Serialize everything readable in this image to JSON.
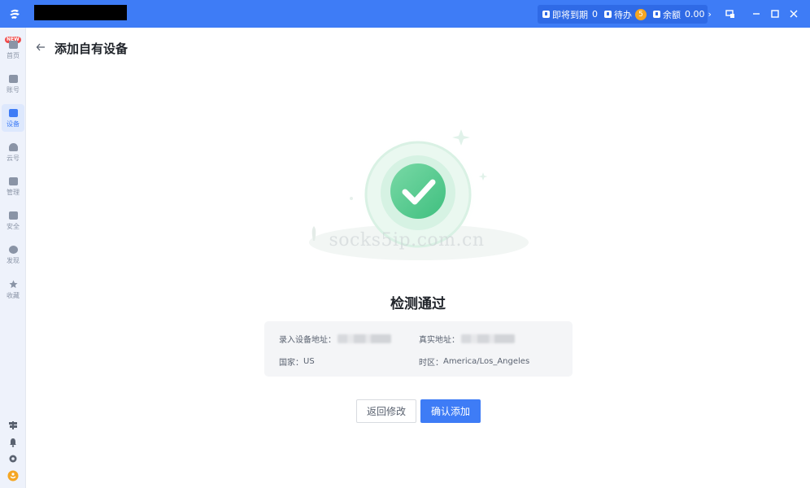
{
  "titlebar": {
    "status": {
      "expiring_label": "即将到期",
      "expiring_count": "0",
      "todo_label": "待办",
      "todo_count": "5",
      "balance_label": "余额",
      "balance_value": "0.00"
    },
    "accent_color": "#3e7cf6"
  },
  "sidebar": {
    "items": [
      {
        "label": "首页",
        "icon": "home-icon",
        "tag": "NEW"
      },
      {
        "label": "账号",
        "icon": "store-icon"
      },
      {
        "label": "设备",
        "icon": "device-icon",
        "active": true
      },
      {
        "label": "云号",
        "icon": "cloud-icon"
      },
      {
        "label": "管理",
        "icon": "manage-icon"
      },
      {
        "label": "安全",
        "icon": "security-icon"
      },
      {
        "label": "发现",
        "icon": "compass-icon"
      },
      {
        "label": "收藏",
        "icon": "star-icon"
      }
    ]
  },
  "page": {
    "title": "添加自有设备",
    "watermark": "socks5ip.com.cn",
    "result_title": "检测通过"
  },
  "info": {
    "device_address_label": "录入设备地址：",
    "real_address_label": "真实地址：",
    "country_label": "国家：",
    "country_value": "US",
    "timezone_label": "时区：",
    "timezone_value": "America/Los_Angeles"
  },
  "actions": {
    "back_label": "返回修改",
    "confirm_label": "确认添加"
  }
}
